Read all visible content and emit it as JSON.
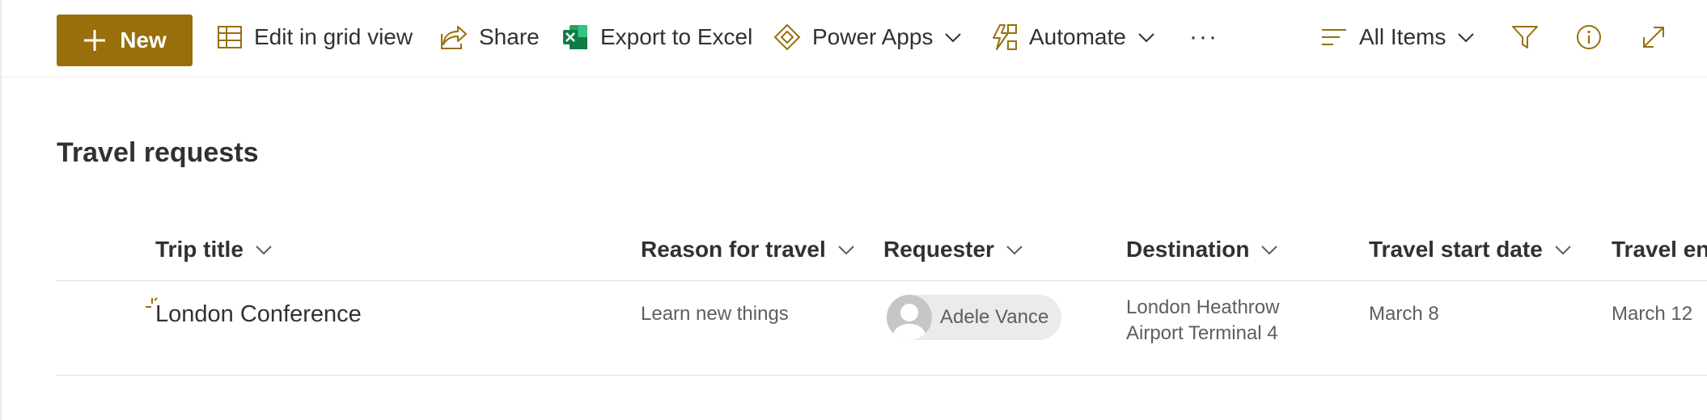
{
  "colors": {
    "accent": "#986f0b",
    "text": "#323130",
    "secondary_text": "#605e5c",
    "divider": "#e1dfdd"
  },
  "command_bar": {
    "new_label": "New",
    "edit_grid_label": "Edit in grid view",
    "share_label": "Share",
    "export_label": "Export to Excel",
    "power_apps_label": "Power Apps",
    "automate_label": "Automate",
    "more_label": "···",
    "view_label": "All Items"
  },
  "list": {
    "title": "Travel requests",
    "columns": [
      {
        "label": "Trip title"
      },
      {
        "label": "Reason for travel"
      },
      {
        "label": "Requester"
      },
      {
        "label": "Destination"
      },
      {
        "label": "Travel start date"
      },
      {
        "label": "Travel end date"
      }
    ],
    "rows": [
      {
        "trip_title": "London Conference",
        "reason": "Learn new things",
        "requester": "Adele Vance",
        "destination_line1": "London Heathrow",
        "destination_line2": "Airport Terminal 4",
        "start_date": "March 8",
        "end_date": "March 12"
      }
    ]
  },
  "icons": {
    "new": "plus-icon",
    "edit_grid": "grid-icon",
    "share": "share-icon",
    "export": "excel-icon",
    "power_apps": "power-apps-icon",
    "automate": "automate-icon",
    "view": "view-lines-icon",
    "filter": "filter-icon",
    "info": "info-icon",
    "expand": "expand-icon",
    "sort": "chevron-down-icon",
    "new_item": "new-item-indicator-icon",
    "avatar": "person-avatar-icon"
  }
}
